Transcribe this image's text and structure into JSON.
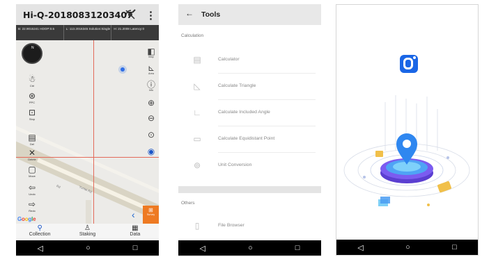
{
  "map_screen": {
    "title": "Hi-Q-20180831203407",
    "status": [
      "B: 22.9015241  HDOP:0.5",
      "L: 113.2016345  Solution:Single",
      "H: 21.2008  Latency:0"
    ],
    "left_buttons": [
      {
        "label": "Ctrl",
        "icon": "person-walk-icon"
      },
      {
        "label": "PPC",
        "icon": "satellite-icon"
      },
      {
        "label": "Stop",
        "icon": "mailbox-icon"
      },
      {
        "label": "Del",
        "icon": "folder-icon"
      },
      {
        "label": "Delete",
        "icon": "cross-icon"
      },
      {
        "label": "Move",
        "icon": "square-icon"
      },
      {
        "label": "Undo",
        "icon": "undo-icon"
      },
      {
        "label": "Redo",
        "icon": "redo-icon"
      }
    ],
    "right_buttons": [
      {
        "label": "Map",
        "icon": "layers-icon"
      },
      {
        "label": "Area",
        "icon": "ruler-icon"
      },
      {
        "label": "Info",
        "icon": "info-icon"
      },
      {
        "label": "",
        "icon": "zoom-in-icon"
      },
      {
        "label": "",
        "icon": "zoom-out-icon"
      },
      {
        "label": "",
        "icon": "focus-icon"
      },
      {
        "label": "",
        "icon": "globe-icon"
      }
    ],
    "compass_label": "N",
    "google_label": "Google",
    "orange_button": "Survey",
    "road_labels": [
      "Yuntai Rd",
      "Rd"
    ],
    "tabs": [
      {
        "label": "Collection",
        "icon": "location-pin-icon",
        "active": true
      },
      {
        "label": "Staking",
        "icon": "staking-icon",
        "active": false
      },
      {
        "label": "Data",
        "icon": "table-icon",
        "active": false
      }
    ]
  },
  "tools_screen": {
    "title": "Tools",
    "back_icon": "arrow-left-icon",
    "sections": [
      {
        "label": "Calculation",
        "items": [
          {
            "label": "Calculator",
            "icon": "calculator-icon"
          },
          {
            "label": "Calculate Triangle",
            "icon": "triangle-icon"
          },
          {
            "label": "Calculate Included Angle",
            "icon": "angle-icon"
          },
          {
            "label": "Calculate Equidistant Point",
            "icon": "ruler-icon"
          },
          {
            "label": "Unit Conversion",
            "icon": "conversion-icon"
          }
        ]
      },
      {
        "label": "Others",
        "items": [
          {
            "label": "File Browser",
            "icon": "book-icon"
          }
        ]
      }
    ]
  },
  "splash_screen": {
    "logo_icon": "q-logo-icon",
    "brand_color": "#1a66e6"
  },
  "nav_bar": {
    "back": "◁",
    "home": "○",
    "recent": "□"
  }
}
